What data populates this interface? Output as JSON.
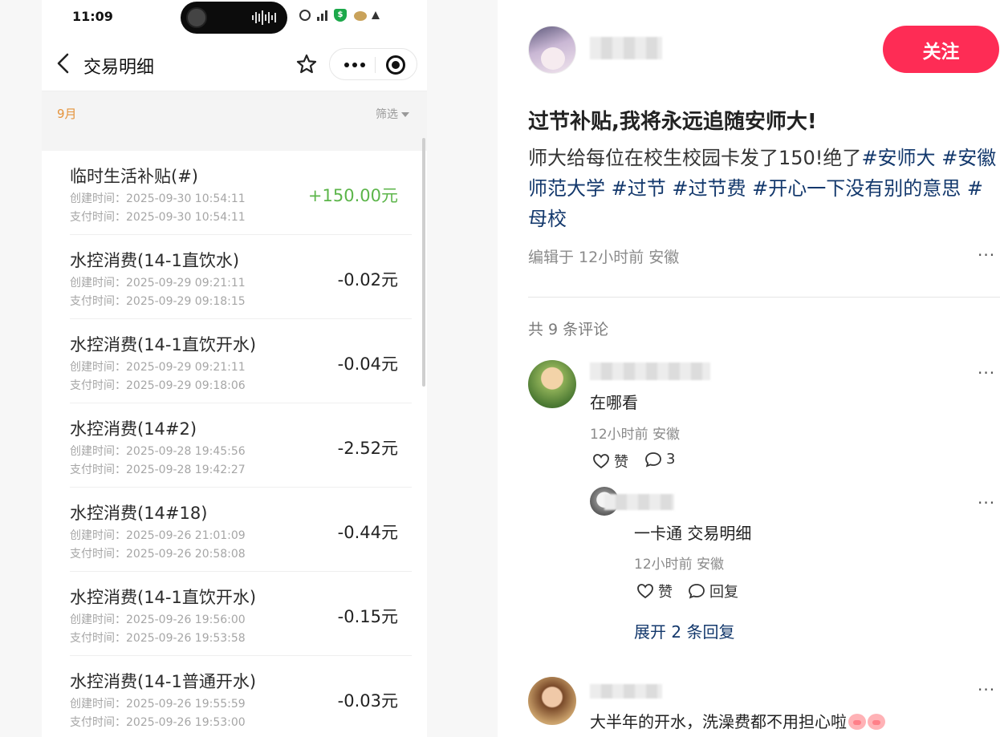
{
  "status_bar": {
    "time": "11:09"
  },
  "mini_app": {
    "title": "交易明细",
    "month": "9月",
    "filter_label": "筛选",
    "transactions": [
      {
        "title": "临时生活补贴(#)",
        "created": "创建时间：2025-09-30 10:54:11",
        "paid": "支付时间：2025-09-30 10:54:11",
        "amount": "+150.00元",
        "positive": true
      },
      {
        "title": "水控消费(14-1直饮水)",
        "created": "创建时间：2025-09-29 09:21:11",
        "paid": "支付时间：2025-09-29 09:18:15",
        "amount": "-0.02元"
      },
      {
        "title": "水控消费(14-1直饮开水)",
        "created": "创建时间：2025-09-29 09:21:11",
        "paid": "支付时间：2025-09-29 09:18:06",
        "amount": "-0.04元"
      },
      {
        "title": "水控消费(14#2)",
        "created": "创建时间：2025-09-28 19:45:56",
        "paid": "支付时间：2025-09-28 19:42:27",
        "amount": "-2.52元"
      },
      {
        "title": "水控消费(14#18)",
        "created": "创建时间：2025-09-26 21:01:09",
        "paid": "支付时间：2025-09-26 20:58:08",
        "amount": "-0.44元"
      },
      {
        "title": "水控消费(14-1直饮开水)",
        "created": "创建时间：2025-09-26 19:56:00",
        "paid": "支付时间：2025-09-26 19:53:58",
        "amount": "-0.15元"
      },
      {
        "title": "水控消费(14-1普通开水)",
        "created": "创建时间：2025-09-26 19:55:59",
        "paid": "支付时间：2025-09-26 19:53:00",
        "amount": "-0.03元"
      }
    ]
  },
  "post": {
    "follow_label": "关注",
    "title": "过节补贴,我将永远追随安师大!",
    "body_text": "师大给每位在校生校园卡发了150!绝了",
    "tags": [
      "#安师大",
      "#安徽师范大学",
      "#过节",
      "#过节费",
      "#开心一下没有别的意思",
      "#母校"
    ],
    "meta": "编辑于 12小时前 安徽",
    "more_label": "···",
    "comment_count": "共 9 条评论",
    "comments": [
      {
        "text": "在哪看",
        "meta": "12小时前 安徽",
        "like_label": "赞",
        "reply_count": "3",
        "reply": {
          "text": "一卡通 交易明细",
          "meta": "12小时前 安徽",
          "like_label": "赞",
          "reply_label": "回复"
        },
        "expand_label": "展开 2 条回复"
      },
      {
        "text": "大半年的开水，洗澡费都不用担心啦"
      }
    ]
  },
  "icons": [
    "back-arrow-icon",
    "star-icon",
    "more-icon",
    "target-icon",
    "heart-icon",
    "comment-icon",
    "pig-emoji-icon"
  ],
  "colors": {
    "follow": "#fe2c55",
    "positive": "#5cb54a",
    "tag": "#13386c",
    "month": "#e5933b"
  }
}
